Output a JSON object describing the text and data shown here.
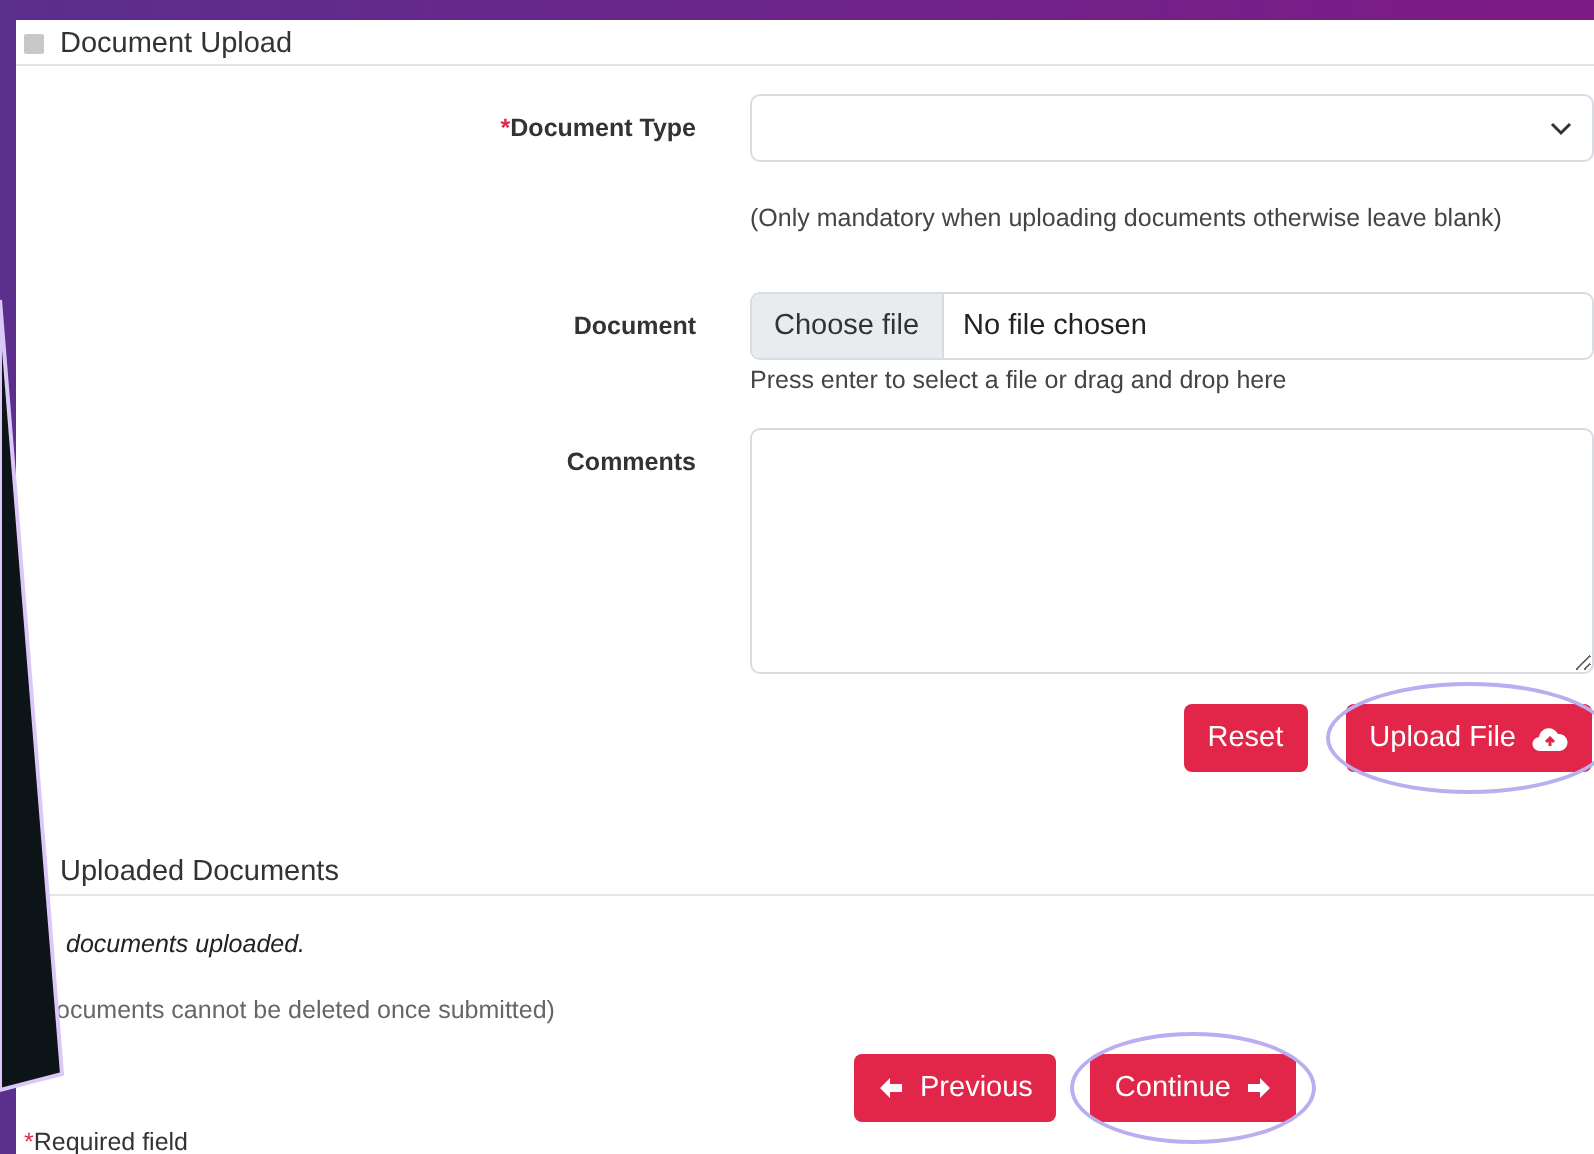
{
  "upload_section": {
    "title": "Document Upload",
    "fields": [
      {
        "kind": "select",
        "label": "Document Type",
        "required_mark": "*",
        "hint": "(Only mandatory when uploading documents otherwise leave blank)"
      },
      {
        "kind": "file",
        "label": "Document",
        "button": "Choose file",
        "value": "No file chosen",
        "help": "Press enter to select a file or drag and drop here"
      },
      {
        "kind": "textarea",
        "label": "Comments"
      }
    ],
    "buttons": [
      {
        "label": "Reset",
        "kind": "plain",
        "highlighted": false
      },
      {
        "label": "Upload File",
        "kind": "upload",
        "highlighted": true
      }
    ]
  },
  "uploaded_section": {
    "title": "Uploaded Documents",
    "empty_message": "documents uploaded.",
    "note": "ocuments cannot be deleted once submitted)"
  },
  "nav_buttons": [
    {
      "label": "Previous",
      "kind": "previous",
      "highlighted": false
    },
    {
      "label": "Continue",
      "kind": "next",
      "highlighted": true
    }
  ],
  "required_note": {
    "mark": "*",
    "text": "Required field"
  }
}
